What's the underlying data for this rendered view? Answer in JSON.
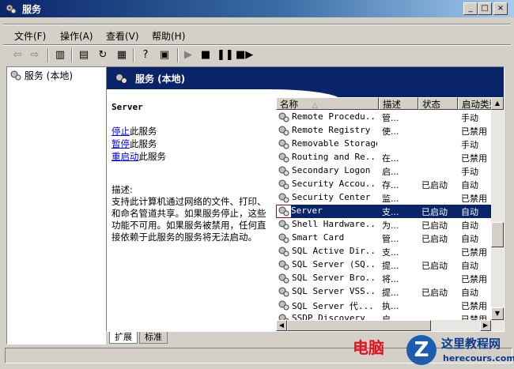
{
  "window": {
    "title": "服务"
  },
  "caption_buttons": {
    "min": "_",
    "max": "□",
    "close": "×"
  },
  "menu": [
    "文件(F)",
    "操作(A)",
    "查看(V)",
    "帮助(H)"
  ],
  "tree": {
    "root_label": "服务 (本地)"
  },
  "banner": {
    "title": "服务 (本地)"
  },
  "details": {
    "service_name": "Server",
    "actions": [
      {
        "link": "停止",
        "suffix": "此服务"
      },
      {
        "link": "暂停",
        "suffix": "此服务"
      },
      {
        "link": "重启动",
        "suffix": "此服务"
      }
    ],
    "desc_label": "描述:",
    "desc_text": "支持此计算机通过网络的文件、打印、和命名管道共享。如果服务停止，这些功能不可用。如果服务被禁用，任何直接依赖于此服务的服务将无法启动。"
  },
  "list": {
    "columns": [
      "名称",
      "描述",
      "状态",
      "启动类型"
    ],
    "rows": [
      {
        "name": "Remote Procedu...",
        "desc": "管...",
        "status": "",
        "startup": "手动"
      },
      {
        "name": "Remote Registry",
        "desc": "使...",
        "status": "",
        "startup": "已禁用"
      },
      {
        "name": "Removable Storage",
        "desc": "",
        "status": "",
        "startup": "手动"
      },
      {
        "name": "Routing and Re...",
        "desc": "在...",
        "status": "",
        "startup": "已禁用"
      },
      {
        "name": "Secondary Logon",
        "desc": "启...",
        "status": "",
        "startup": "手动"
      },
      {
        "name": "Security Accou...",
        "desc": "存...",
        "status": "已启动",
        "startup": "自动"
      },
      {
        "name": "Security Center",
        "desc": "监...",
        "status": "",
        "startup": "已禁用"
      },
      {
        "name": "Server",
        "desc": "支...",
        "status": "已启动",
        "startup": "自动",
        "selected": true
      },
      {
        "name": "Shell Hardware...",
        "desc": "为...",
        "status": "已启动",
        "startup": "自动"
      },
      {
        "name": "Smart Card",
        "desc": "管...",
        "status": "已启动",
        "startup": "自动"
      },
      {
        "name": "SQL Active Dir...",
        "desc": "支...",
        "status": "",
        "startup": "已禁用"
      },
      {
        "name": "SQL Server (SQ...",
        "desc": "提...",
        "status": "已启动",
        "startup": "自动"
      },
      {
        "name": "SQL Server Bro...",
        "desc": "将...",
        "status": "",
        "startup": "已禁用"
      },
      {
        "name": "SQL Server VSS...",
        "desc": "提...",
        "status": "已启动",
        "startup": "自动"
      },
      {
        "name": "SQL Server 代...",
        "desc": "执...",
        "status": "",
        "startup": "已禁用"
      },
      {
        "name": "SSDP Discovery",
        "desc": "启...",
        "status": "",
        "startup": "已禁用"
      }
    ]
  },
  "tabs": [
    "扩展",
    "标准"
  ],
  "watermark": {
    "text": "电脑",
    "logo_char": "Z",
    "site_name": "这里教程网",
    "site_url": "herecours.com"
  },
  "colors": {
    "title_active": "#0a246a",
    "selection": "#0a246a",
    "link": "#0000ff"
  }
}
